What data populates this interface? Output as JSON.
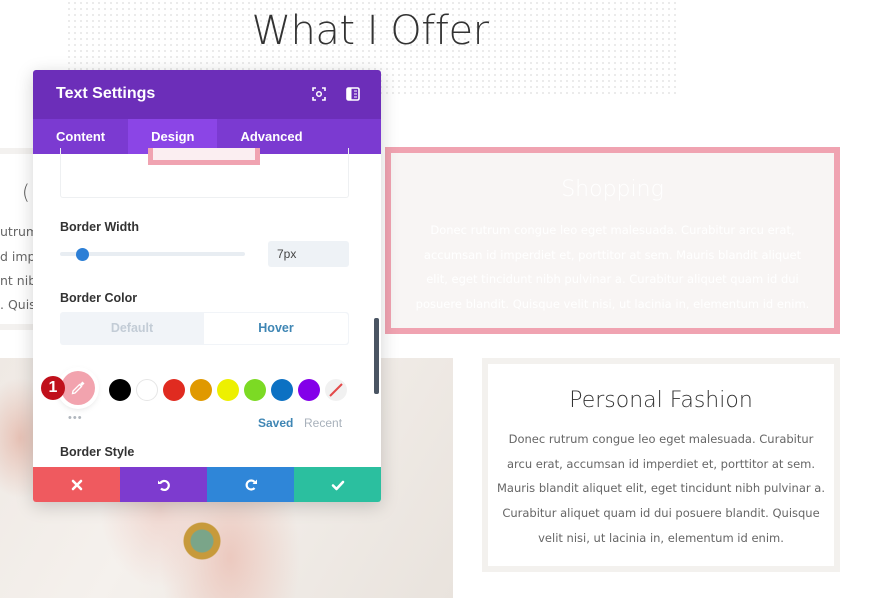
{
  "page": {
    "title": "What I Offer"
  },
  "left_card": {
    "title_fragment": "(",
    "lines": [
      "utrum",
      "d impe",
      "nt nib",
      ". Quis"
    ]
  },
  "shopping_card": {
    "title": "Shopping",
    "body": "Donec rutrum congue leo eget malesuada. Curabitur arcu erat, accumsan id imperdiet et, porttitor at sem. Mauris blandit aliquet elit, eget tincidunt nibh pulvinar a. Curabitur aliquet quam id dui posuere blandit. Quisque velit nisi, ut lacinia in, elementum id enim.",
    "border_color": "#f0a3b1"
  },
  "fashion_card": {
    "title": "Personal Fashion",
    "body": "Donec rutrum congue leo eget malesuada. Curabitur arcu erat, accumsan id imperdiet et, porttitor at sem. Mauris blandit aliquet elit, eget tincidunt nibh pulvinar a. Curabitur aliquet quam id dui posuere blandit. Quisque velit nisi, ut lacinia in, elementum id enim."
  },
  "modal": {
    "title": "Text Settings",
    "header_icons": [
      "fullscreen-icon",
      "sidebar-toggle-icon"
    ],
    "tabs": [
      {
        "label": "Content",
        "active": false
      },
      {
        "label": "Design",
        "active": true
      },
      {
        "label": "Advanced",
        "active": false
      }
    ],
    "border_width": {
      "label": "Border Width",
      "value": "7px",
      "slider_fraction": 0.12
    },
    "border_color": {
      "label": "Border Color",
      "toggle": [
        "Default",
        "Hover"
      ],
      "active_toggle": "Hover",
      "current_color": "#f2a3ae",
      "step_badge": "1",
      "swatches": [
        "#000000",
        "#ffffff",
        "#e02b20",
        "#e09900",
        "#edf000",
        "#7cda24",
        "#0c71c3",
        "#8300e9"
      ],
      "more_label": "•••",
      "saved_label": "Saved",
      "recent_label": "Recent"
    },
    "border_style": {
      "label": "Border Style"
    },
    "footer": {
      "cancel": "cancel",
      "undo": "undo",
      "redo": "redo",
      "save": "save"
    }
  },
  "colors": {
    "header": "#6c2eb9",
    "tabs": "#7b3ad1",
    "active_tab": "#8b45e6",
    "accent_blue": "#2c7fd6",
    "cancel": "#ef5a5f",
    "undo": "#7d3bcf",
    "redo": "#2f86d8",
    "save": "#2bbf9f"
  }
}
